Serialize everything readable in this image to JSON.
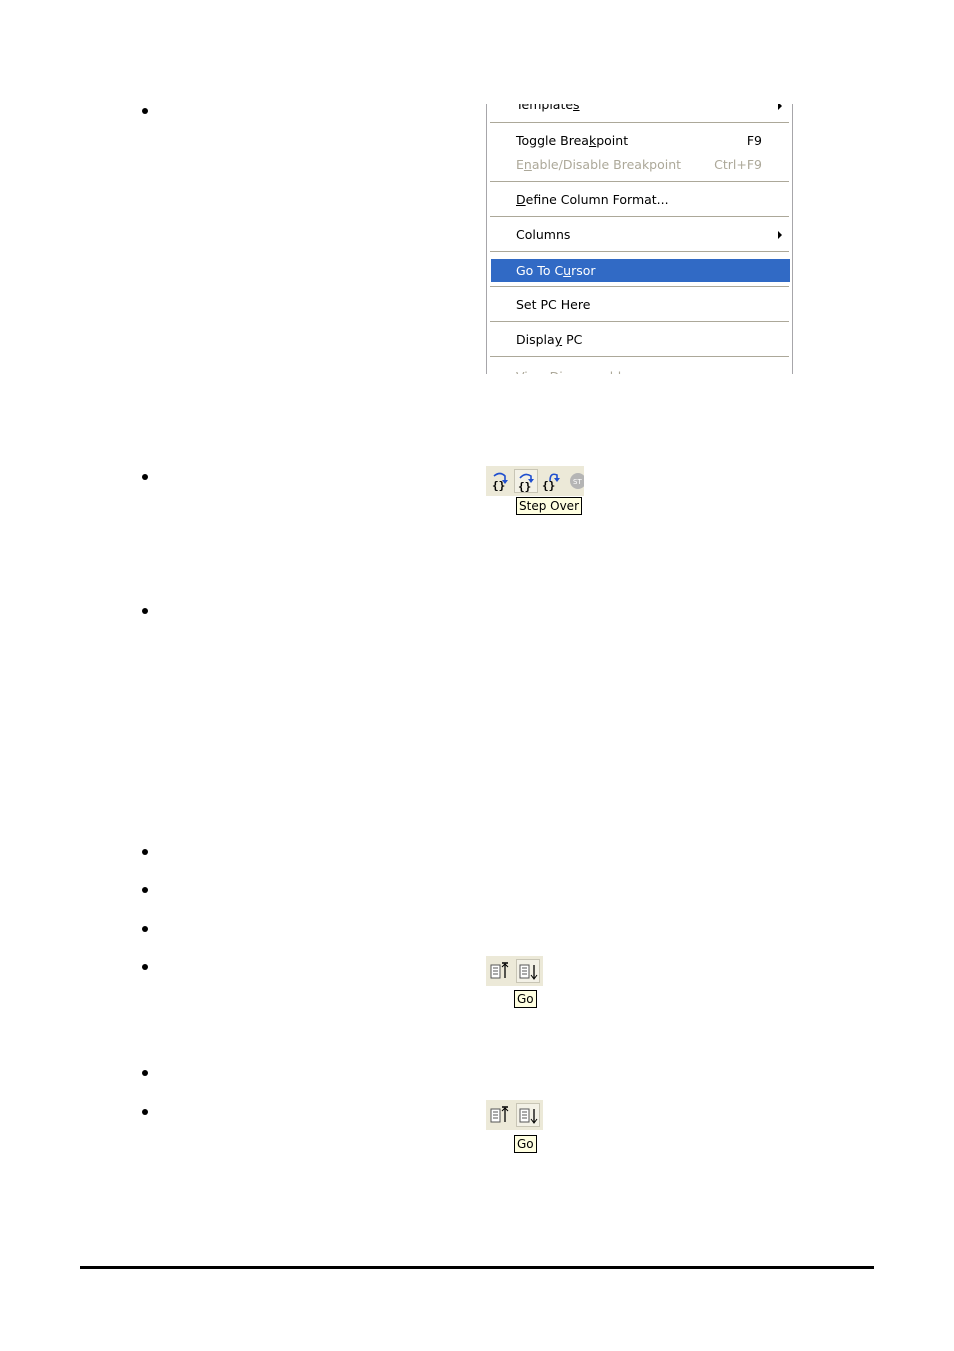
{
  "bullets_count": 9,
  "context_menu": {
    "items": [
      {
        "label_pre": "Template",
        "label_ul": "s",
        "label_post": "",
        "shortcut": "",
        "state": "partial",
        "submenu": true
      },
      {
        "label_pre": "Toggle Brea",
        "label_ul": "k",
        "label_post": "point",
        "shortcut": "F9",
        "state": "normal",
        "submenu": false
      },
      {
        "label_pre": "E",
        "label_ul": "n",
        "label_post": "able/Disable Breakpoint",
        "shortcut": "Ctrl+F9",
        "state": "disabled",
        "submenu": false
      },
      {
        "label_pre": "",
        "label_ul": "D",
        "label_post": "efine Column Format...",
        "shortcut": "",
        "state": "normal",
        "submenu": false
      },
      {
        "label_pre": "Columns",
        "label_ul": "",
        "label_post": "",
        "shortcut": "",
        "state": "normal",
        "submenu": true
      },
      {
        "label_pre": "Go To C",
        "label_ul": "u",
        "label_post": "rsor",
        "shortcut": "",
        "state": "selected",
        "submenu": false
      },
      {
        "label_pre": "Set PC Here",
        "label_ul": "",
        "label_post": "",
        "shortcut": "",
        "state": "normal",
        "submenu": false
      },
      {
        "label_pre": "Displa",
        "label_ul": "y",
        "label_post": " PC",
        "shortcut": "",
        "state": "normal",
        "submenu": false
      },
      {
        "label_pre": "View Disassembly",
        "label_ul": "",
        "label_post": "",
        "shortcut": "",
        "state": "partial-disabled",
        "submenu": false
      }
    ],
    "highlight_color": "#316ac5"
  },
  "step_toolbar": {
    "buttons": [
      "step-into",
      "step-over",
      "step-out",
      "stop"
    ],
    "tooltip": "Step Over"
  },
  "go_toolbar_1": {
    "buttons": [
      "go-to-top",
      "go"
    ],
    "tooltip": "Go"
  },
  "go_toolbar_2": {
    "buttons": [
      "go-to-top",
      "go"
    ],
    "tooltip": "Go"
  }
}
